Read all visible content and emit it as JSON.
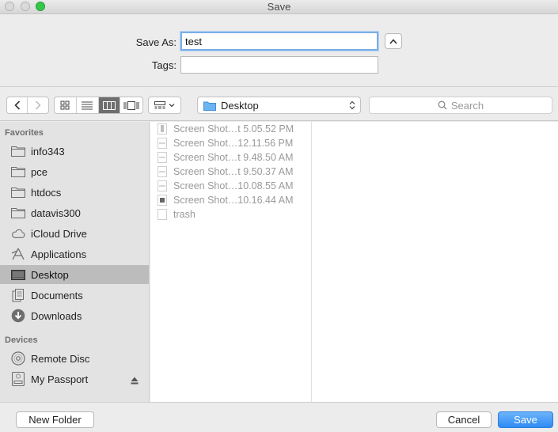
{
  "window": {
    "title": "Save"
  },
  "form": {
    "save_as_label": "Save As:",
    "save_as_value": "test",
    "tags_label": "Tags:",
    "tags_value": ""
  },
  "toolbar": {
    "location": "Desktop",
    "search_placeholder": "Search"
  },
  "sidebar": {
    "favorites_header": "Favorites",
    "favorites": [
      {
        "label": "info343",
        "icon": "folder-icon"
      },
      {
        "label": "pce",
        "icon": "folder-icon"
      },
      {
        "label": "htdocs",
        "icon": "folder-icon"
      },
      {
        "label": "datavis300",
        "icon": "folder-icon"
      },
      {
        "label": "iCloud Drive",
        "icon": "cloud-icon"
      },
      {
        "label": "Applications",
        "icon": "applications-icon"
      },
      {
        "label": "Desktop",
        "icon": "desktop-icon",
        "selected": true
      },
      {
        "label": "Documents",
        "icon": "documents-icon"
      },
      {
        "label": "Downloads",
        "icon": "downloads-icon"
      }
    ],
    "devices_header": "Devices",
    "devices": [
      {
        "label": "Remote Disc",
        "icon": "disc-icon"
      },
      {
        "label": "My Passport",
        "icon": "drive-icon"
      }
    ]
  },
  "files": [
    {
      "name": "Screen Shot…t 5.05.52 PM"
    },
    {
      "name": "Screen Shot…12.11.56 PM"
    },
    {
      "name": "Screen Shot…t 9.48.50 AM"
    },
    {
      "name": "Screen Shot…t 9.50.37 AM"
    },
    {
      "name": "Screen Shot…10.08.55 AM"
    },
    {
      "name": "Screen Shot…10.16.44 AM"
    },
    {
      "name": "trash"
    }
  ],
  "footer": {
    "new_folder_label": "New Folder",
    "cancel_label": "Cancel",
    "save_label": "Save"
  },
  "colors": {
    "accent": "#2f8bf3",
    "sidebar_selected": "#bcbcbc",
    "sidebar_bg": "#e3e3e3"
  }
}
